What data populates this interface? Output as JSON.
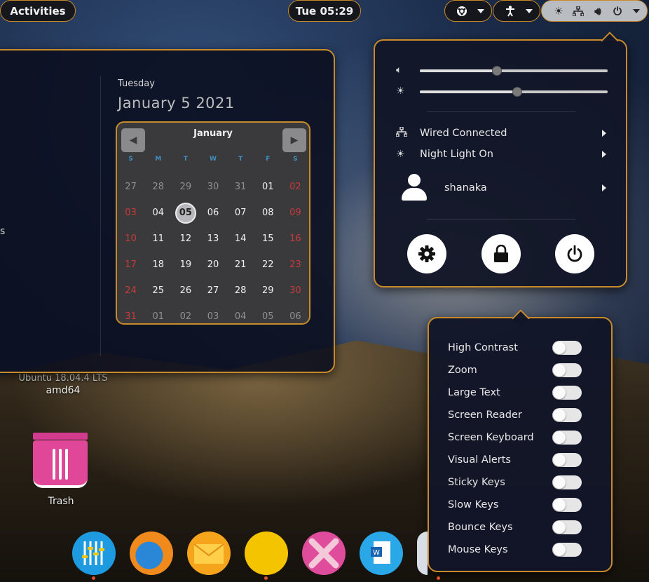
{
  "topbar": {
    "activities": "Activities",
    "clock": "Tue 05:29",
    "tray_icons": [
      "brightness-icon",
      "network-wired-icon",
      "volume-icon",
      "power-icon"
    ]
  },
  "calendar": {
    "day_name": "Tuesday",
    "date_full": "January  5 2021",
    "month": "January",
    "weekday_headers": [
      "S",
      "M",
      "T",
      "W",
      "T",
      "F",
      "S"
    ],
    "weeks": [
      [
        "27",
        "28",
        "29",
        "30",
        "31",
        "01",
        "02"
      ],
      [
        "03",
        "04",
        "05",
        "06",
        "07",
        "08",
        "09"
      ],
      [
        "10",
        "11",
        "12",
        "13",
        "14",
        "15",
        "16"
      ],
      [
        "17",
        "18",
        "19",
        "20",
        "21",
        "22",
        "23"
      ],
      [
        "24",
        "25",
        "26",
        "27",
        "28",
        "29",
        "30"
      ],
      [
        "31",
        "01",
        "02",
        "03",
        "04",
        "05",
        "06"
      ]
    ],
    "today": "05",
    "colors": {
      "weekend": "#c83a3a",
      "other_month": "#8f8f8f",
      "header": "#3f8fc4"
    }
  },
  "system_menu": {
    "volume_level": 0.41,
    "brightness_level": 0.52,
    "wired": "Wired Connected",
    "night_light": "Night Light On",
    "user": "shanaka",
    "buttons": [
      "settings-icon",
      "lock-icon",
      "power-icon"
    ]
  },
  "accessibility": {
    "items": [
      {
        "label": "High Contrast",
        "on": false
      },
      {
        "label": "Zoom",
        "on": false
      },
      {
        "label": "Large Text",
        "on": false
      },
      {
        "label": "Screen Reader",
        "on": false
      },
      {
        "label": "Screen Keyboard",
        "on": false
      },
      {
        "label": "Visual Alerts",
        "on": false
      },
      {
        "label": "Sticky Keys",
        "on": false
      },
      {
        "label": "Slow Keys",
        "on": false
      },
      {
        "label": "Bounce Keys",
        "on": false
      },
      {
        "label": "Mouse Keys",
        "on": false
      }
    ]
  },
  "desktop": {
    "partial_label": "Ubuntu 18.04.4 LTS",
    "arch_label": "amd64",
    "trash_label": "Trash"
  },
  "dock": {
    "items": [
      {
        "name": "equalizer-app-icon",
        "color": "#1e9be0",
        "running": true
      },
      {
        "name": "firefox-icon",
        "color": "#2a86d6",
        "running": false
      },
      {
        "name": "mail-icon",
        "color": "#f7a41d",
        "running": false
      },
      {
        "name": "notes-icon",
        "color": "#f5c400",
        "running": true
      },
      {
        "name": "handshake-app-icon",
        "color": "#e04c9c",
        "running": false
      },
      {
        "name": "word-processor-icon",
        "color": "#29a7e6",
        "running": false
      },
      {
        "name": "partial-app-icon",
        "color": "#d8dde6",
        "running": true
      }
    ]
  }
}
